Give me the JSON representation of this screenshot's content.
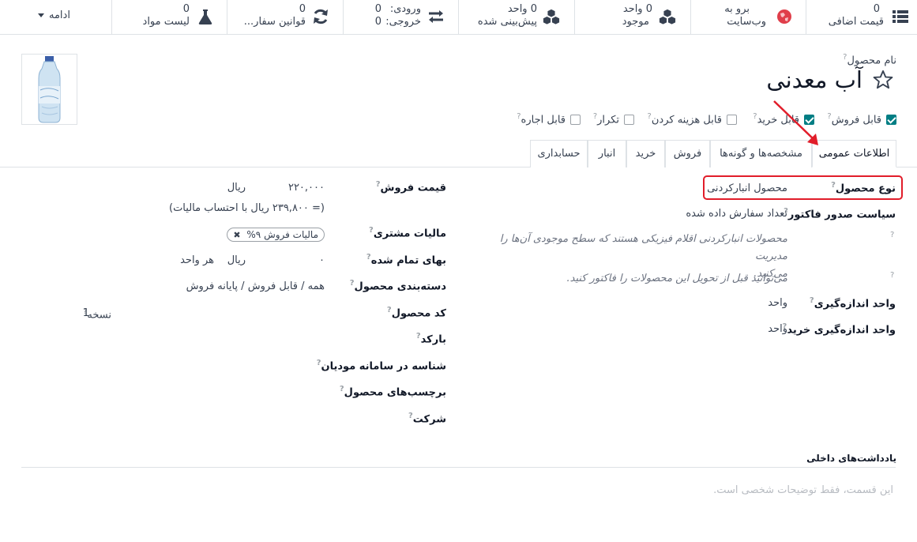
{
  "smart_buttons": {
    "extra_price": {
      "count": "0",
      "label": "قیمت اضافی"
    },
    "website": {
      "line1": "برو به",
      "line2": "وب‌سایت"
    },
    "on_hand": {
      "line1": "0 واحد",
      "line2": "موجود"
    },
    "forecasted": {
      "line1": "0 واحد",
      "line2": "پیش‌بینی شده"
    },
    "in_out": {
      "in_label": "ورودی:",
      "in_value": "0",
      "out_label": "خروجی:",
      "out_value": "0"
    },
    "reorder": {
      "count": "0",
      "label": "قوانین سفار..."
    },
    "bom": {
      "count": "0",
      "label": "لیست مواد"
    },
    "more_label": "ادامه"
  },
  "product": {
    "name_label": "نام محصول",
    "name": "آب معدنی",
    "checkboxes": [
      {
        "label": "قابل فروش",
        "checked": true
      },
      {
        "label": "قابل خرید",
        "checked": true
      },
      {
        "label": "قابل هزینه کردن",
        "checked": false
      },
      {
        "label": "تکرار",
        "checked": false
      },
      {
        "label": "قابل اجاره",
        "checked": false
      }
    ]
  },
  "tabs": [
    {
      "label": "اطلاعات عمومی",
      "active": true
    },
    {
      "label": "مشخصه‌ها و گونه‌ها",
      "active": false
    },
    {
      "label": "فروش",
      "active": false
    },
    {
      "label": "خرید",
      "active": false
    },
    {
      "label": "انبار",
      "active": false
    },
    {
      "label": "حسابداری",
      "active": false
    }
  ],
  "general": {
    "product_type_label": "نوع محصول",
    "product_type_value": "محصول انبارکردنی",
    "invoice_policy_label": "سیاست صدور فاکتور",
    "invoice_policy_value": "تعداد سفارش داده شده",
    "hint1_line1": "محصولات انبارکردنی اقلام فیزیکی هستند که سطح موجودی آن‌ها را مدیریت",
    "hint1_line2": "می‌کنید.",
    "hint2": "می‌توانید قبل از تحویل این محصولات را فاکتور کنید.",
    "uom_label": "واحد اندازه‌گیری",
    "uom_value": "واحد",
    "purchase_uom_label": "واحد اندازه‌گیری خرید",
    "purchase_uom_value": "واحد",
    "sales_price_label": "قیمت فروش",
    "sales_price_value": "۲۲۰,۰۰۰",
    "sales_price_currency": "ریال",
    "tax_included_text": "(= ۲۳۹,۸۰۰ ریال با احتساب مالیات)",
    "customer_tax_label": "مالیات مشتری",
    "customer_tax_badge": "مالیات فروش ۹%",
    "cost_label": "بهای تمام شده",
    "cost_value": "۰",
    "cost_currency": "ریال",
    "cost_unit": "هر واحد",
    "category_label": "دسته‌بندی محصول",
    "category_value": "همه / قابل فروش / پایانه فروش",
    "reference_label": "کد محصول",
    "barcode_label": "بارکد",
    "moadian_label": "شناسه در سامانه مودیان",
    "tags_label": "برچسب‌های محصول",
    "company_label": "شرکت",
    "version_label": "نسخه",
    "version_value": "1"
  },
  "notes": {
    "title": "یادداشت‌های داخلی",
    "placeholder": "این قسمت، فقط توضیحات شخصی است."
  },
  "colors": {
    "accent": "#017e84",
    "annotation_red": "#e11d2a"
  }
}
